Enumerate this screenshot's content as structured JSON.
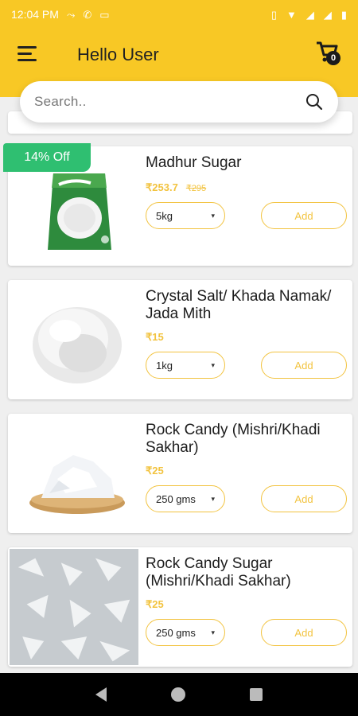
{
  "status": {
    "time": "12:04 PM"
  },
  "header": {
    "title": "Hello User",
    "cart_count": "0"
  },
  "search": {
    "placeholder": "Search.."
  },
  "products": [
    {
      "name": "Madhur Sugar",
      "price": "₹253.7",
      "mrp": "₹295",
      "discount": "14% Off",
      "qty": "5kg",
      "add": "Add",
      "image": "madhur-sugar-pack-image"
    },
    {
      "name": "Crystal Salt/ Khada Namak/ Jada Mith",
      "price": "₹15",
      "qty": "1kg",
      "add": "Add",
      "image": "crystal-salt-image"
    },
    {
      "name": "Rock Candy (Mishri/Khadi Sakhar)",
      "price": "₹25",
      "qty": "250 gms",
      "add": "Add",
      "image": "rock-candy-bowl-image"
    },
    {
      "name": "Rock Candy Sugar (Mishri/Khadi Sakhar)",
      "price": "₹25",
      "qty": "250 gms",
      "add": "Add",
      "image": "rock-candy-closeup-image"
    }
  ],
  "colors": {
    "accent": "#f8c825",
    "price": "#f2c33f",
    "badge": "#2fbf71"
  }
}
